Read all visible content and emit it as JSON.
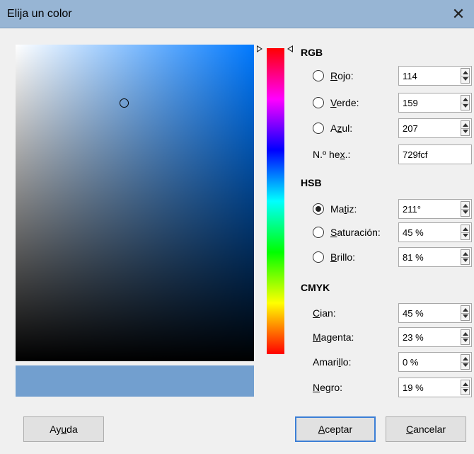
{
  "window": {
    "title": "Elija un color",
    "close_glyph": "✕"
  },
  "picker": {
    "preview_color": "#729fcf",
    "field_hue_color": "#0079ff"
  },
  "rgb": {
    "title": "RGB",
    "rojo": {
      "mn": "R",
      "rest": "ojo:",
      "value": "114"
    },
    "verde": {
      "mn": "V",
      "rest": "erde:",
      "value": "159"
    },
    "azul": {
      "pre": "A",
      "mn": "z",
      "rest": "ul:",
      "value": "207"
    },
    "hex": {
      "pre": "N.º he",
      "mn": "x",
      "rest": ".:",
      "value": "729fcf"
    }
  },
  "hsb": {
    "title": "HSB",
    "matiz": {
      "pre": "Ma",
      "mn": "t",
      "rest": "iz:",
      "value": "211°"
    },
    "saturacion": {
      "mn": "S",
      "rest": "aturación:",
      "value": "45 %"
    },
    "brillo": {
      "mn": "B",
      "rest": "rillo:",
      "value": "81 %"
    }
  },
  "cmyk": {
    "title": "CMYK",
    "cian": {
      "mn": "C",
      "rest": "ian:",
      "value": "45 %"
    },
    "magenta": {
      "mn": "M",
      "rest": "agenta:",
      "value": "23 %"
    },
    "amarillo": {
      "pre": "Amari",
      "mn": "l",
      "rest": "lo:",
      "value": "0 %"
    },
    "negro": {
      "mn": "N",
      "rest": "egro:",
      "value": "19 %"
    }
  },
  "buttons": {
    "ayuda": {
      "pre": "Ay",
      "mn": "u",
      "rest": "da"
    },
    "aceptar": {
      "mn": "A",
      "rest": "ceptar"
    },
    "cancelar": {
      "mn": "C",
      "rest": "ancelar"
    }
  },
  "selected_mode": "matiz"
}
